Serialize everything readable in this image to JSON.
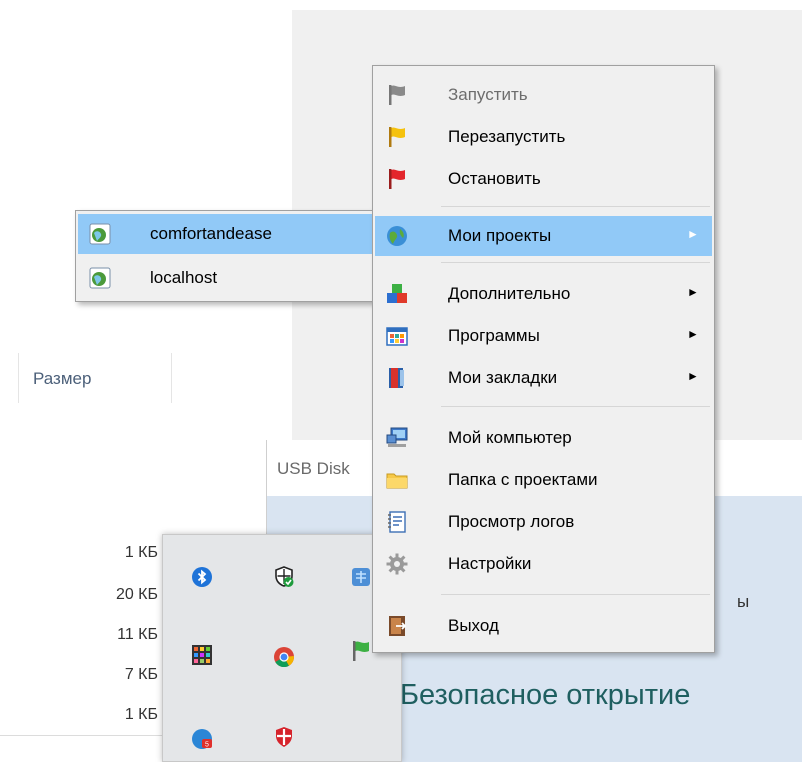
{
  "explorer": {
    "column_size_header": "Размер",
    "sizes": [
      "1 КБ",
      "20 КБ",
      "11 КБ",
      "7 КБ",
      "1 КБ"
    ]
  },
  "usb_dialog": {
    "title": "USB Disk",
    "partial_text": "ы",
    "safe_open_text": "Безопасное открытие"
  },
  "context_menu": {
    "items": [
      {
        "label": "Запустить",
        "icon": "gray-flag-icon",
        "disabled": true
      },
      {
        "label": "Перезапустить",
        "icon": "yellow-flag-icon"
      },
      {
        "label": "Остановить",
        "icon": "red-flag-icon"
      },
      {
        "label": "Мои проекты",
        "icon": "globe-icon",
        "submenu": true,
        "highlighted": true
      },
      {
        "label": "Дополнительно",
        "icon": "blocks-icon",
        "submenu": true
      },
      {
        "label": "Программы",
        "icon": "programs-grid-icon",
        "submenu": true
      },
      {
        "label": "Мои закладки",
        "icon": "bookmarks-icon",
        "submenu": true
      },
      {
        "label": "Мой компьютер",
        "icon": "computer-icon"
      },
      {
        "label": "Папка с проектами",
        "icon": "folder-icon"
      },
      {
        "label": "Просмотр логов",
        "icon": "notepad-icon"
      },
      {
        "label": "Настройки",
        "icon": "gear-icon"
      },
      {
        "label": "Выход",
        "icon": "exit-door-icon"
      }
    ],
    "submenu_arrow": "►"
  },
  "projects_submenu": {
    "items": [
      {
        "label": "comfortandease",
        "icon": "site-globe-icon",
        "highlighted": true
      },
      {
        "label": "localhost",
        "icon": "site-globe-icon"
      }
    ]
  },
  "tray": {
    "icons": [
      "bluetooth-icon",
      "windows-security-icon",
      "network-app-icon",
      "color-grid-app-icon",
      "chrome-icon",
      "green-flag-icon",
      "notification-app-icon",
      "shield-app-icon"
    ]
  },
  "colors": {
    "menu_background": "#f0f0f0",
    "menu_highlight": "#91c9f7",
    "dialog_background": "#d9e4f1",
    "safe_text": "#1f5f60"
  }
}
